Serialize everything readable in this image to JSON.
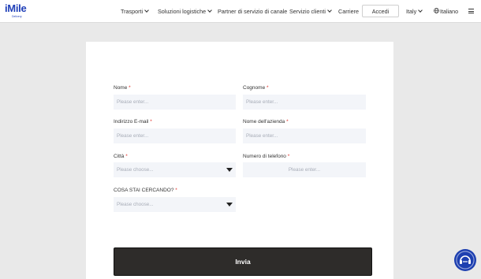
{
  "logo": {
    "text": "iMile",
    "subtext": "Delivery"
  },
  "nav": {
    "trasporti": "Trasporti",
    "soluzioni": "Soluzioni logistiche",
    "partner": "Partner di servizio di canale",
    "servizio": "Servizio clienti",
    "carriere": "Carriere",
    "login": "Accedi",
    "country": "Italy",
    "language": "Italiano"
  },
  "form": {
    "nome": {
      "label": "Nome",
      "placeholder": "Please enter..."
    },
    "cognome": {
      "label": "Cognome",
      "placeholder": "Please enter..."
    },
    "email": {
      "label": "Indirizzo E-mail",
      "placeholder": "Please enter..."
    },
    "azienda": {
      "label": "Nome dell'azienda",
      "placeholder": "Please enter..."
    },
    "citta": {
      "label": "Città",
      "placeholder": "Please choose..."
    },
    "telefono": {
      "label": "Numero di telefono",
      "placeholder": "Please enter..."
    },
    "cerca": {
      "label": "COSA STAI CERCANDO?",
      "placeholder": "Please choose..."
    },
    "required_mark": "*",
    "submit": "Invia"
  },
  "colors": {
    "brand": "#1f3fb8",
    "submit_bg": "#2e2c2a",
    "field_bg": "#f3f5f9",
    "required": "#e0322b"
  },
  "icons": [
    "chevron-down-icon",
    "globe-icon",
    "menu-icon",
    "caret-down-icon",
    "chat-support-icon"
  ]
}
